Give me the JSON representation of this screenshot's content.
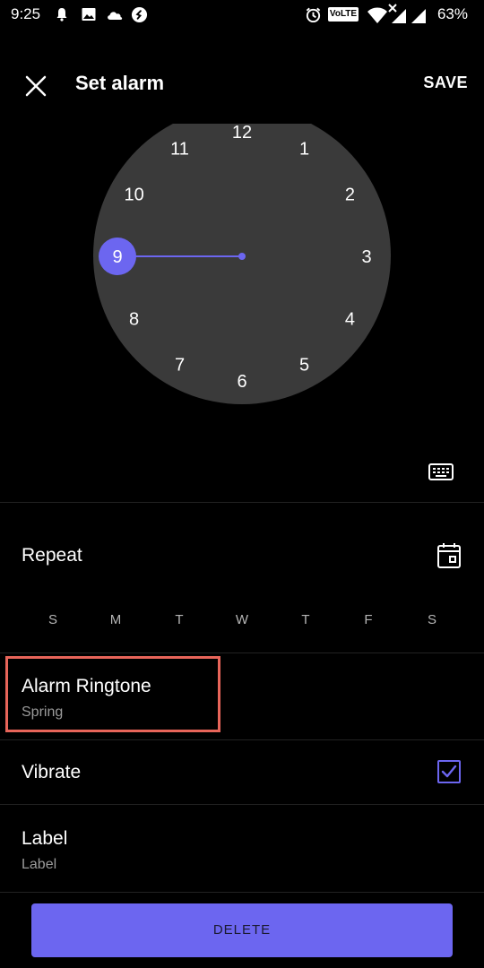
{
  "status_bar": {
    "time": "9:25",
    "battery": "63%",
    "icons": [
      "notification-bell-icon",
      "image-icon",
      "cloud-icon",
      "shazam-icon",
      "alarm-icon",
      "volte-icon",
      "wifi-icon",
      "signal-icon",
      "battery-icon"
    ],
    "volte": "VoLTE"
  },
  "app_bar": {
    "title": "Set alarm",
    "save_label": "SAVE",
    "close_icon": "close-icon"
  },
  "clock": {
    "numbers": [
      "12",
      "1",
      "2",
      "3",
      "4",
      "5",
      "6",
      "7",
      "8",
      "9",
      "10",
      "11"
    ],
    "selected": "9",
    "face_color": "#3a3a3a",
    "accent": "#6c66f0"
  },
  "keyboard_icon": "keyboard-icon",
  "repeat": {
    "label": "Repeat",
    "calendar_icon": "calendar-icon",
    "days": [
      "S",
      "M",
      "T",
      "W",
      "T",
      "F",
      "S"
    ]
  },
  "ringtone": {
    "title": "Alarm Ringtone",
    "value": "Spring",
    "highlight_color": "#e8655a"
  },
  "vibrate": {
    "label": "Vibrate",
    "checked": true
  },
  "label_row": {
    "title": "Label",
    "placeholder": "Label"
  },
  "delete_button": {
    "label": "DELETE",
    "color": "#6c66f0"
  }
}
